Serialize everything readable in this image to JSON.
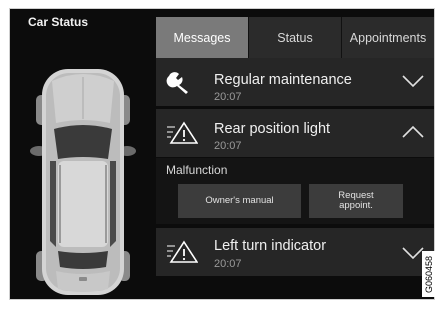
{
  "screen": {
    "title": "Car Status",
    "tabs": [
      {
        "label": "Messages",
        "active": true
      },
      {
        "label": "Status",
        "active": false
      },
      {
        "label": "Appointments",
        "active": false
      }
    ]
  },
  "messages": [
    {
      "icon": "wrench-icon",
      "title": "Regular maintenance",
      "time": "20:07",
      "expanded": false
    },
    {
      "icon": "warning-light-icon",
      "title": "Rear position light",
      "time": "20:07",
      "expanded": true,
      "detail": {
        "status": "Malfunction",
        "buttons": [
          "Owner's manual",
          "Request appoint."
        ]
      }
    },
    {
      "icon": "warning-light-icon",
      "title": "Left turn indicator",
      "time": "20:07",
      "expanded": false
    }
  ],
  "figure_code": "G060458",
  "colors": {
    "background": "#0c0c0c",
    "active_tab": "#7a7a7a",
    "row": "#262626",
    "button": "#3c3c3c"
  }
}
